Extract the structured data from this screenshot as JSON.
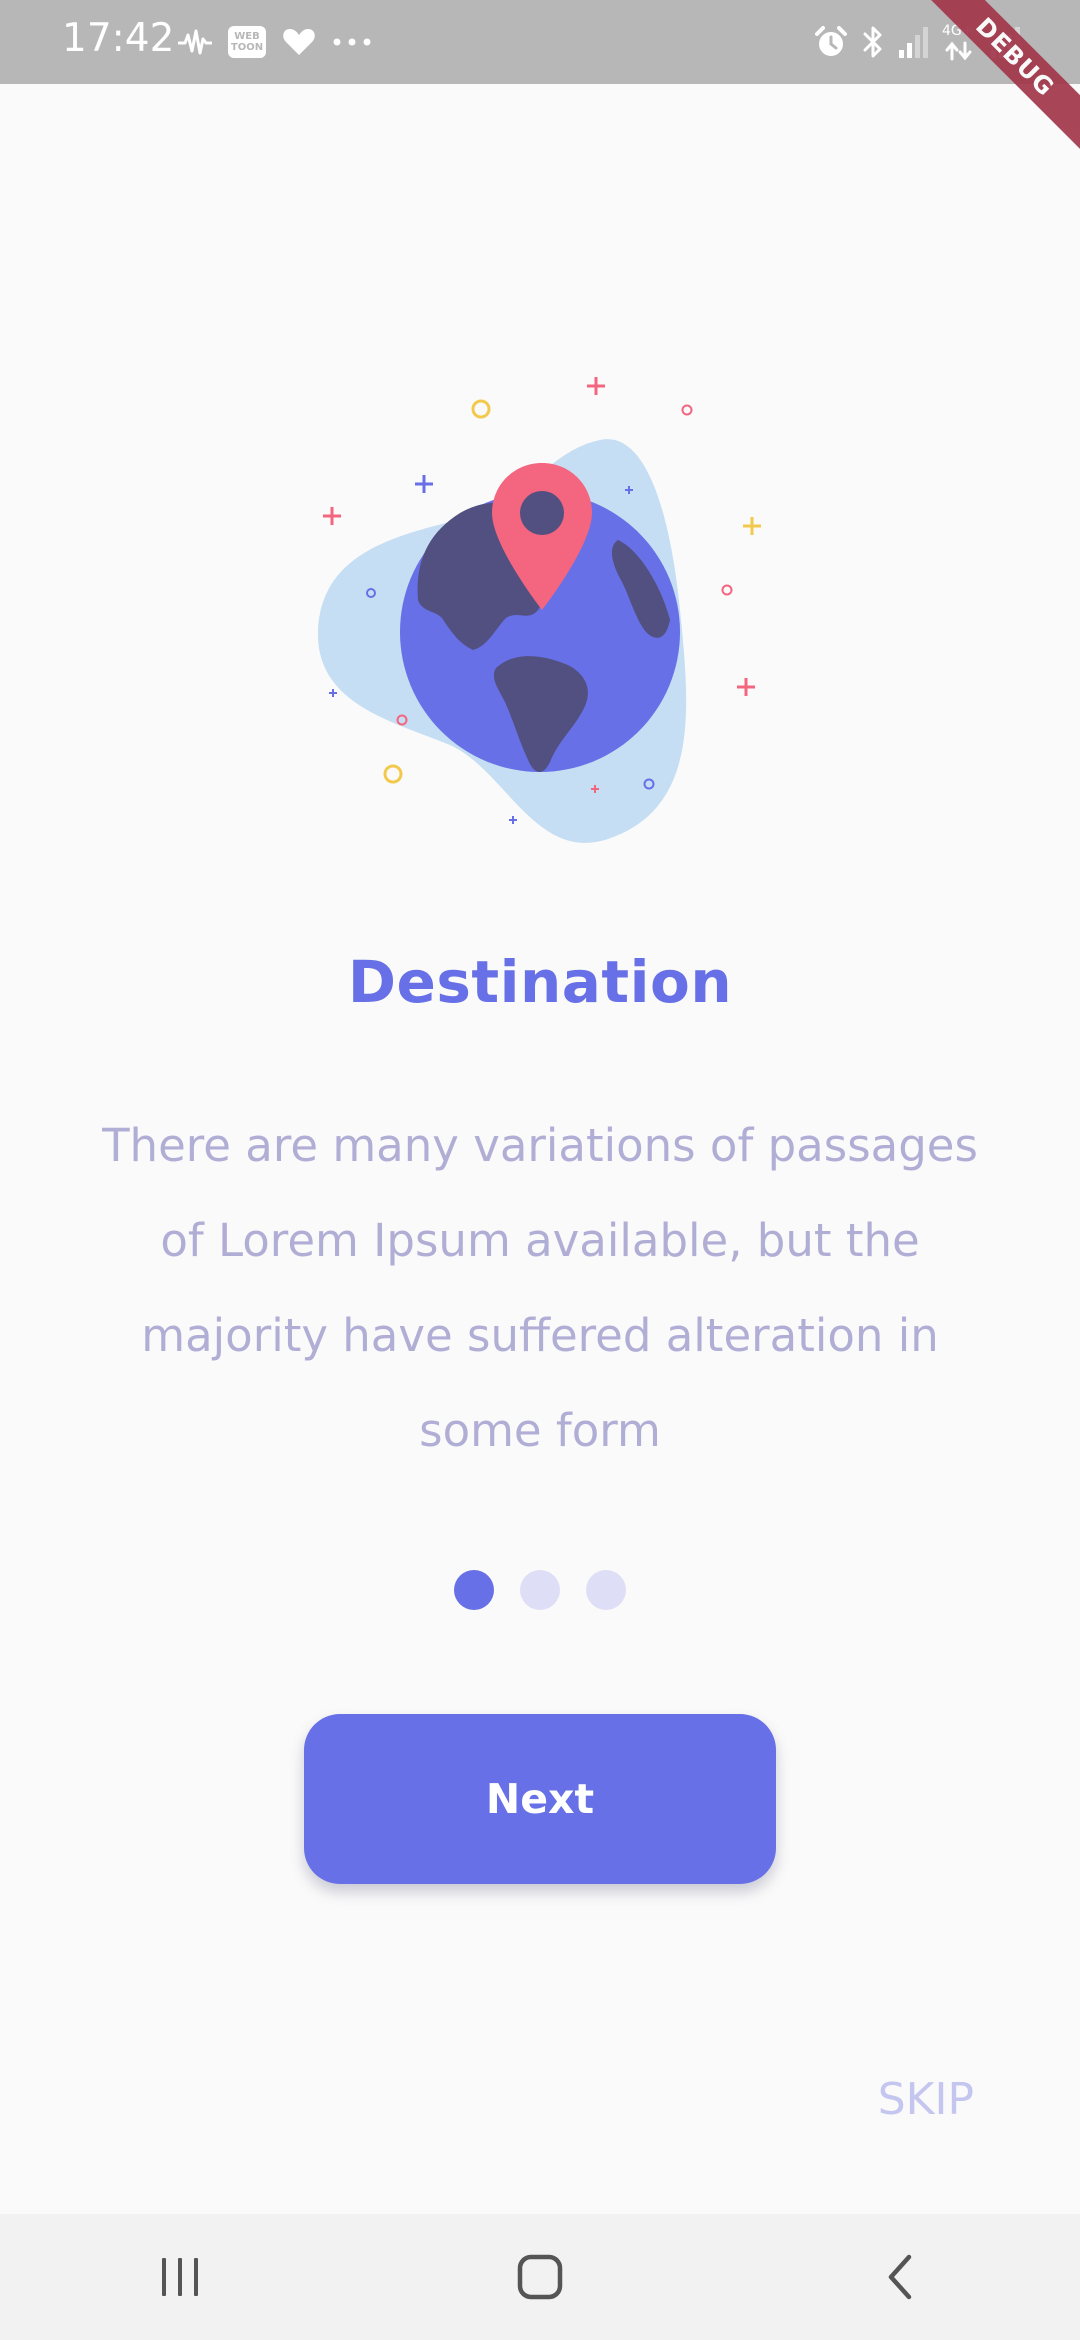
{
  "status_bar": {
    "time": "17:42",
    "left_icons": [
      "audio-wave-icon",
      "webtoon-icon",
      "heart-icon",
      "more-dots-icon"
    ],
    "webtoon_label": "WEB TOON",
    "right_icons": [
      "alarm-icon",
      "bluetooth-icon",
      "signal-icon",
      "data-arrows-icon",
      "signal-icon-2"
    ],
    "network_label": "4G+"
  },
  "debug_banner": "DEBUG",
  "onboarding": {
    "illustration": "globe-location-pin-illustration",
    "title": "Destination",
    "description": "There are many variations of passages of Lorem Ipsum available, but the majority have suffered alteration in some form",
    "pages": 3,
    "current_page": 1,
    "next_label": "Next",
    "skip_label": "SKIP"
  },
  "navigation_bar": {
    "buttons": [
      "recent-apps-icon",
      "home-icon",
      "back-icon"
    ]
  },
  "colors": {
    "primary": "#6770e6",
    "description_text": "#b1aed6",
    "dot_inactive": "#dedff6",
    "pin": "#f4657f",
    "blob": "#c6def3",
    "continents": "#525080",
    "status_bar": "#b7b7b7",
    "skip": "#c4c6f0"
  }
}
